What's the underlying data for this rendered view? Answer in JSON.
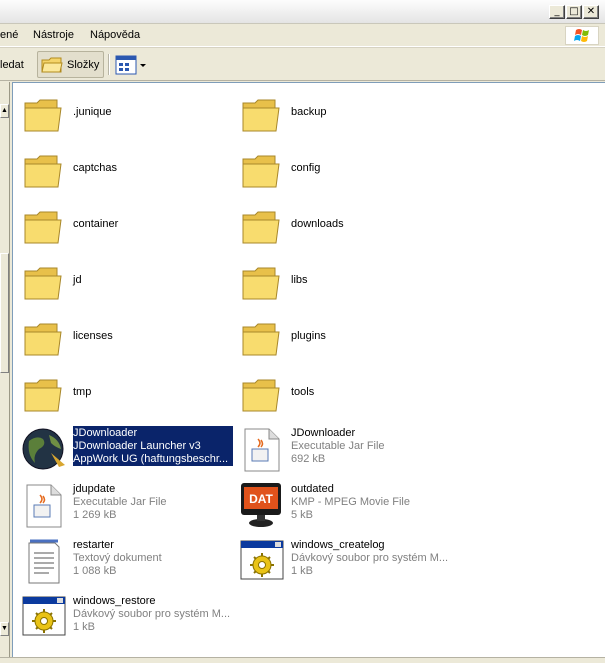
{
  "menu": {
    "items": [
      "ené",
      "Nástroje",
      "Nápověda"
    ]
  },
  "toolbar": {
    "search_partial": "ledat",
    "folders_label": "Složky"
  },
  "folders": [
    ".junique",
    "backup",
    "captchas",
    "config",
    "container",
    "downloads",
    "jd",
    "libs",
    "licenses",
    "plugins",
    "tmp",
    "tools"
  ],
  "files": [
    {
      "name": "JDownloader",
      "type": "JDownloader Launcher v3",
      "extra": "AppWork UG (haftungsbeschr...",
      "icon": "jdownloader-globe-icon",
      "selected": true
    },
    {
      "name": "JDownloader",
      "type": "Executable Jar File",
      "extra": "692 kB",
      "icon": "java-jar-icon",
      "selected": false
    },
    {
      "name": "jdupdate",
      "type": "Executable Jar File",
      "extra": "1 269 kB",
      "icon": "java-jar-icon",
      "selected": false
    },
    {
      "name": "outdated",
      "type": "KMP - MPEG Movie File",
      "extra": "5 kB",
      "icon": "dat-movie-icon",
      "selected": false
    },
    {
      "name": "restarter",
      "type": "Textový dokument",
      "extra": "1 088 kB",
      "icon": "text-document-icon",
      "selected": false
    },
    {
      "name": "windows_createlog",
      "type": "Dávkový soubor pro systém M...",
      "extra": "1 kB",
      "icon": "batch-file-icon",
      "selected": false
    },
    {
      "name": "windows_restore",
      "type": "Dávkový soubor pro systém M...",
      "extra": "1 kB",
      "icon": "batch-file-icon",
      "selected": false
    }
  ],
  "colors": {
    "selection": "#0a246a",
    "folder": "#f8dc6e",
    "window_bg": "#ece9d8"
  }
}
